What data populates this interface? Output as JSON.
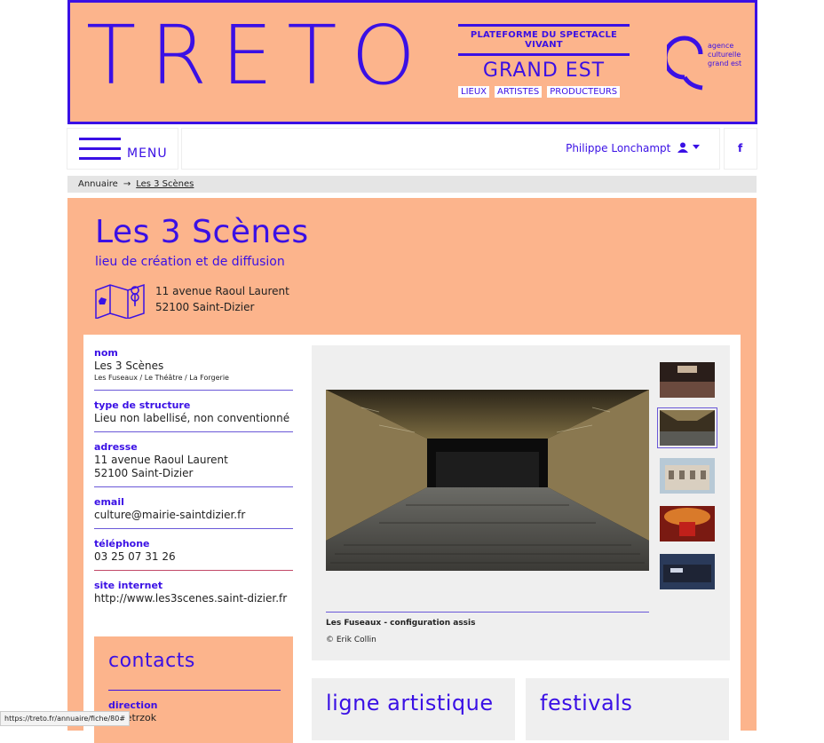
{
  "banner": {
    "logo": "TRETO",
    "platform_top": "PLATEFORME DU SPECTACLE VIVANT",
    "platform_region": "GRAND EST",
    "tags": [
      "LIEUX",
      "ARTISTES",
      "PRODUCTEURS"
    ],
    "agency_lines": [
      "agence",
      "culturelle",
      "grand est"
    ]
  },
  "nav": {
    "menu_label": "MENU",
    "user_name": "Philippe Lonchampt",
    "facebook_label": "f"
  },
  "breadcrumb": {
    "parent": "Annuaire",
    "separator": "→",
    "current": "Les 3 Scènes"
  },
  "venue": {
    "title": "Les 3 Scènes",
    "subtitle": "lieu de création et de diffusion",
    "address_line1": "11 avenue Raoul Laurent",
    "address_line2": "52100 Saint-Dizier"
  },
  "details": {
    "nom_label": "nom",
    "nom_value": "Les 3 Scènes",
    "nom_sub": "Les Fuseaux / Le Théâtre / La Forgerie",
    "type_label": "type de structure",
    "type_value": "Lieu non labellisé, non conventionné",
    "adresse_label": "adresse",
    "adresse_line1": "11 avenue Raoul Laurent",
    "adresse_line2": "52100 Saint-Dizier",
    "email_label": "email",
    "email_value": "culture@mairie-saintdizier.fr",
    "tel_label": "téléphone",
    "tel_value": "03 25 07 31 26",
    "site_label": "site internet",
    "site_value": "http://www.les3scenes.saint-dizier.fr"
  },
  "contacts": {
    "title": "contacts",
    "role": "direction",
    "name": "a Pietrzok"
  },
  "gallery": {
    "caption": "Les Fuseaux - configuration assis",
    "credit": "© Erik Collin",
    "selected_index": 1
  },
  "cards": {
    "ligne": "ligne artistique",
    "festivals": "festivals"
  },
  "status_url": "https://treto.fr/annuaire/fiche/80#",
  "colors": {
    "peach": "#fcb48c",
    "blue": "#3a10e5"
  }
}
